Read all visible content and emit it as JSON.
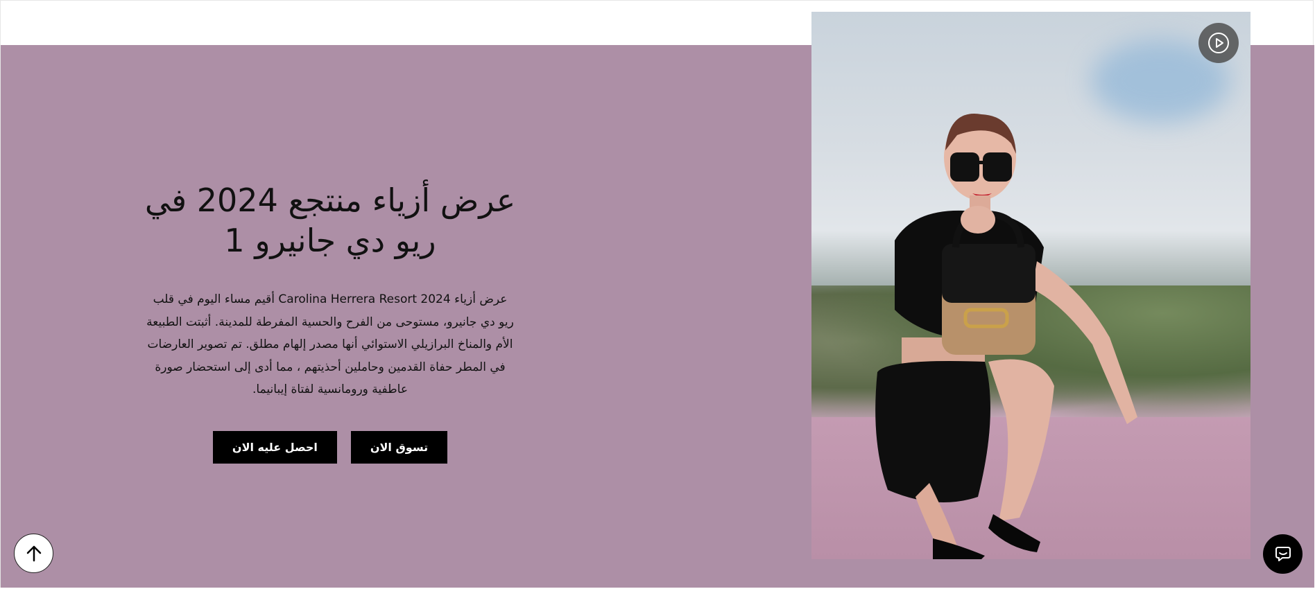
{
  "hero": {
    "title_line1": "عرض أزياء منتجع 2024 في",
    "title_line2": "ريو دي جانيرو 1",
    "description": "عرض أزياء Carolina Herrera Resort 2024 أقيم مساء اليوم في قلب ريو دي جانيرو، مستوحى من الفرح والحسية المفرطة للمدينة. أثبتت الطبيعة الأم والمناخ البرازيلي الاستوائي أنها مصدر إلهام مطلق. تم تصوير العارضات في المطر حفاة القدمين وحاملين أحذيتهم ، مما أدى إلى استحضار صورة عاطفية ورومانسية لفتاة إيبانيما.",
    "shop_now_label": "تسوق الان",
    "get_it_label": "احصل عليه الان",
    "background_color": "#ad8fa6"
  },
  "media": {
    "play_icon": "play-circle-icon"
  },
  "floating": {
    "chat_icon": "chat-bubble-icon",
    "scroll_top_icon": "arrow-up-icon"
  }
}
